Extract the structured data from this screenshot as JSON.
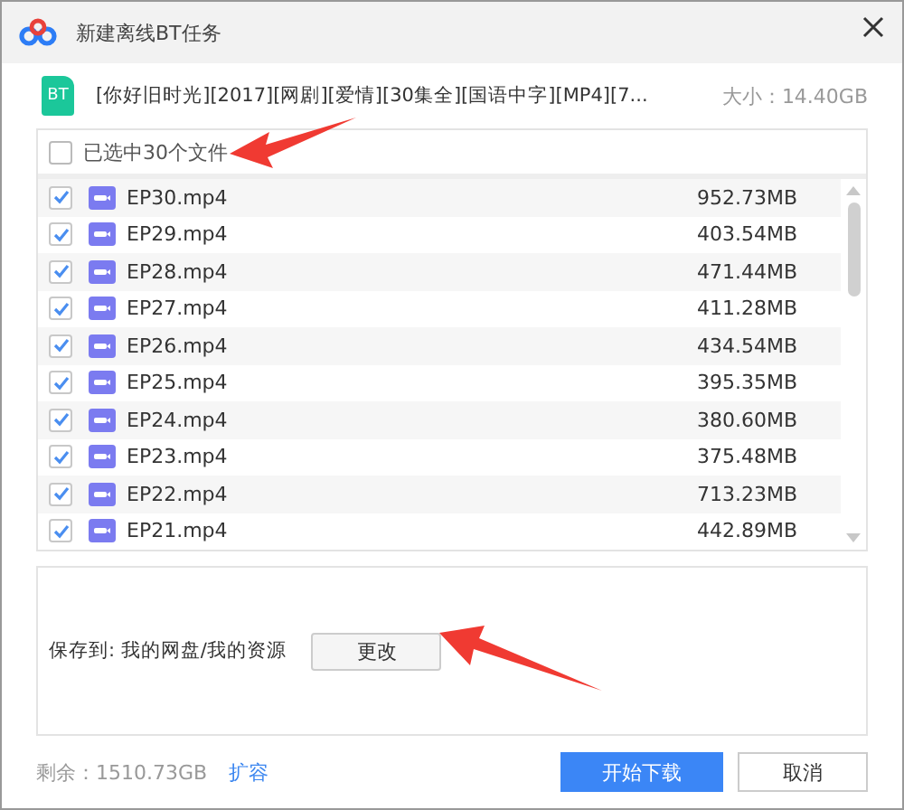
{
  "window": {
    "title": "新建离线BT任务"
  },
  "torrent": {
    "badge": "BT",
    "name": "[你好旧时光][2017][网剧][爱情][30集全][国语中字][MP4][7...",
    "size": "大小：14.40GB"
  },
  "select_all": {
    "label": "已选中30个文件",
    "checked": false
  },
  "files": [
    {
      "name": "EP30.mp4",
      "size": "952.73MB",
      "checked": true
    },
    {
      "name": "EP29.mp4",
      "size": "403.54MB",
      "checked": true
    },
    {
      "name": "EP28.mp4",
      "size": "471.44MB",
      "checked": true
    },
    {
      "name": "EP27.mp4",
      "size": "411.28MB",
      "checked": true
    },
    {
      "name": "EP26.mp4",
      "size": "434.54MB",
      "checked": true
    },
    {
      "name": "EP25.mp4",
      "size": "395.35MB",
      "checked": true
    },
    {
      "name": "EP24.mp4",
      "size": "380.60MB",
      "checked": true
    },
    {
      "name": "EP23.mp4",
      "size": "375.48MB",
      "checked": true
    },
    {
      "name": "EP22.mp4",
      "size": "713.23MB",
      "checked": true
    },
    {
      "name": "EP21.mp4",
      "size": "442.89MB",
      "checked": true
    }
  ],
  "save": {
    "label": "保存到: 我的网盘/我的资源",
    "button": "更改"
  },
  "footer": {
    "remaining": "剩余：1510.73GB",
    "expand_link": "扩容",
    "buttons": [
      "开始下载",
      "取消"
    ]
  }
}
